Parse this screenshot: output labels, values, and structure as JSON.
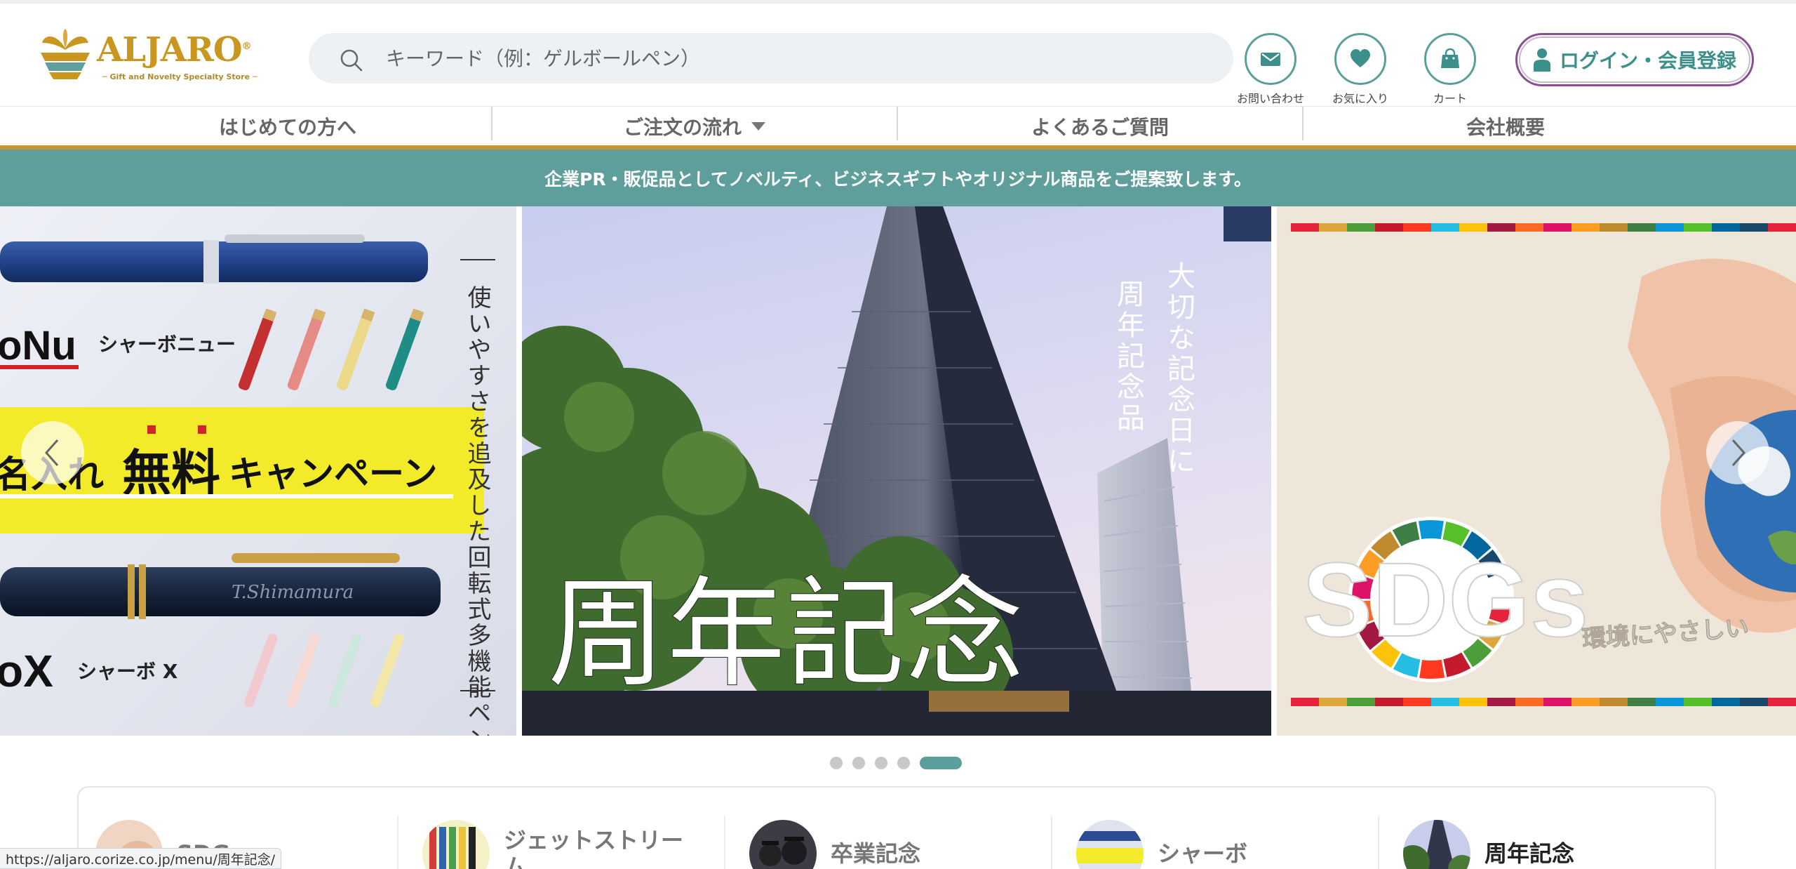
{
  "logo": {
    "name": "ALJARO",
    "reg": "®",
    "tagline": "─ Gift and Novelty Specialty Store ─"
  },
  "search": {
    "placeholder": "キーワード（例：ゲルボールペン）"
  },
  "header_icons": [
    {
      "label": "お問い合わせ",
      "icon": "mail-icon"
    },
    {
      "label": "お気に入り",
      "icon": "heart-icon"
    },
    {
      "label": "カート",
      "icon": "shopping-bag-icon"
    }
  ],
  "login": {
    "label": "ログイン・会員登録"
  },
  "nav": {
    "items": [
      {
        "label": "はじめての方へ"
      },
      {
        "label": "ご注文の流れ"
      },
      {
        "label": "よくあるご質問"
      },
      {
        "label": "会社概要"
      }
    ]
  },
  "banner": {
    "text": "企業PR・販促品としてノベルティ、ビジネスギフトやオリジナル商品をご提案致します。"
  },
  "carousel": {
    "slides": [
      {
        "name": "シャーボ",
        "text_vertical": "使いやすさを追及した回転式多機能ペン",
        "text_nu_logo": "oNu",
        "text_nu": "シャーボニュー",
        "text_campaign_prefix": "名入れ",
        "text_campaign_free": "無料",
        "text_campaign_suffix": "キャンペーン",
        "text_x_logo": "oX",
        "text_x": "シャーボ X",
        "text_engraving": "T.Shimamura"
      },
      {
        "name": "周年記念",
        "text_main": "周年記念",
        "text_vertical_1": "大切な記念日に",
        "text_vertical_2": "周年記念品"
      },
      {
        "name": "SDGs",
        "text_main": "SDGs",
        "text_sub": "環境にやさしい"
      }
    ],
    "dots_count": 5,
    "active_dot": 5
  },
  "categories": [
    {
      "label": "SDGs"
    },
    {
      "label_line1": "ジェットストリー",
      "label_line2": "ム"
    },
    {
      "label": "卒業記念"
    },
    {
      "label": "シャーボ"
    },
    {
      "label": "周年記念"
    }
  ],
  "status_url": "https://aljaro.corize.co.jp/menu/周年記念/",
  "colors": {
    "teal": "#5f9f9b",
    "gold": "#c9942e",
    "purple": "#8a4f92",
    "search_bg": "#eef1f3"
  }
}
